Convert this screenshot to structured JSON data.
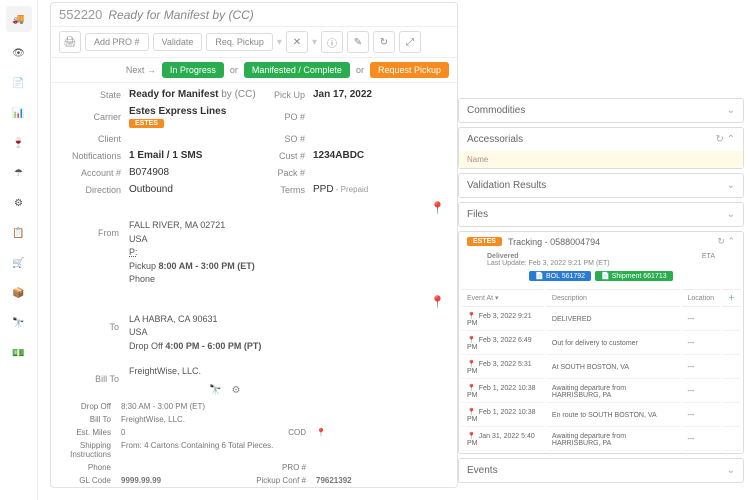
{
  "header": {
    "id": "552220",
    "title": "Ready for Manifest by (CC)",
    "addpro": "Add PRO #",
    "validate": "Validate",
    "reqpickup": "Req. Pickup"
  },
  "next": {
    "label": "Next →",
    "inprog": "In Progress",
    "or1": "or",
    "manifest": "Manifested / Complete",
    "or2": "or",
    "request": "Request Pickup"
  },
  "fields": {
    "state_l": "State",
    "state": "Ready for Manifest",
    "state2": "by (CC)",
    "pickup_l": "Pick Up",
    "pickup": "Jan 17, 2022",
    "carrier_l": "Carrier",
    "carrier": "Estes Express Lines",
    "po_l": "PO #",
    "po": "",
    "client_l": "Client",
    "client": "",
    "so_l": "SO #",
    "so": "",
    "notif_l": "Notifications",
    "notif": "1 Email / 1 SMS",
    "cust_l": "Cust #",
    "cust": "1234ABDC",
    "acct_l": "Account #",
    "acct": "B074908",
    "pack_l": "Pack #",
    "pack": "",
    "dir_l": "Direction",
    "dir": "Outbound",
    "terms_l": "Terms",
    "terms": "PPD",
    "terms2": " - Prepaid"
  },
  "from": {
    "label": "From",
    "city": "FALL RIVER, MA 02721",
    "country": "USA",
    "p": "P:",
    "pickup_l": "Pickup",
    "pickup": "8:00 AM  -  3:00 PM  (ET)",
    "phone_l": "Phone"
  },
  "to": {
    "label": "To",
    "city": "LA HABRA, CA 90631",
    "country": "USA",
    "drop_l": "Drop Off",
    "drop": "4:00 PM  -  6:00 PM  (PT)"
  },
  "billto": {
    "label": "Bill To",
    "name": "FreightWise, LLC."
  },
  "sub": {
    "drop_l": "Drop Off",
    "drop": "8:30 AM  -  3:00 PM  (ET)",
    "billto_l": "Bill To",
    "billto": "FreightWise, LLC.",
    "miles_l": "Est. Miles",
    "miles": "0",
    "cod_l": "COD",
    "ship_l": "Shipping Instructions",
    "ship": "From: 4 Cartons Containing 6 Total Pieces.",
    "phone_l": "Phone",
    "pro_l": "PRO #",
    "gl_l": "GL Code",
    "gl": "9999.99.99",
    "conf_l": "Pickup Conf #",
    "conf": "79621392"
  },
  "panels": {
    "comm": "Commodities",
    "acc": "Accessorials",
    "accname": "Name",
    "val": "Validation Results",
    "files": "Files",
    "events": "Events"
  },
  "tracking": {
    "title": "Tracking - 0588004794",
    "status": "Delivered",
    "updated": "Last Update: Feb 3, 2022 9:21 PM (ET)",
    "bol": "BOL 561792",
    "ship": "Shipment 661713",
    "eta": "ETA",
    "cols": {
      "event": "Event At ▾",
      "desc": "Description",
      "loc": "Location"
    },
    "rows": [
      {
        "t": "Feb 3, 2022 9:21 PM",
        "d": "DELIVERED",
        "l": "---"
      },
      {
        "t": "Feb 3, 2022 6:49 PM",
        "d": "Out for delivery to customer",
        "l": "---"
      },
      {
        "t": "Feb 3, 2022 5:31 PM",
        "d": "At SOUTH BOSTON, VA",
        "l": "---"
      },
      {
        "t": "Feb 1, 2022 10:38 PM",
        "d": "Awaiting departure from HARRISBURG, PA",
        "l": "---"
      },
      {
        "t": "Feb 1, 2022 10:38 PM",
        "d": "En route to SOUTH BOSTON, VA",
        "l": "---"
      },
      {
        "t": "Jan 31, 2022 5:40 PM",
        "d": "Awaiting departure from HARRISBURG, PA",
        "l": "---"
      }
    ]
  },
  "carrier_badge": "ESTES"
}
